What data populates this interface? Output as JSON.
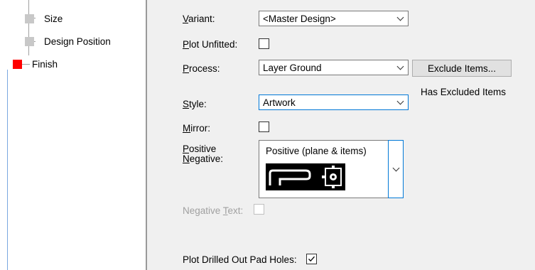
{
  "tree": {
    "items": [
      {
        "label": "Size"
      },
      {
        "label": "Design Position"
      },
      {
        "label": "Finish"
      }
    ]
  },
  "form": {
    "variant": {
      "label_u": "V",
      "label_rest": "ariant:",
      "value": "<Master Design>"
    },
    "plot_unfitted": {
      "label_u": "P",
      "label_rest": "lot Unfitted:",
      "checked": false
    },
    "process": {
      "label_u": "P",
      "label_rest": "rocess:",
      "value": "Layer Ground"
    },
    "exclude_button": "Exclude Items...",
    "excluded_status": "Has Excluded Items",
    "style": {
      "label_u": "S",
      "label_rest": "tyle:",
      "value": "Artwork"
    },
    "mirror": {
      "label_u": "M",
      "label_rest": "irror:",
      "checked": false
    },
    "positive_negative": {
      "label_line1_u": "P",
      "label_line1_rest": "ositive",
      "label_line2_u": "N",
      "label_line2_rest": "egative:",
      "value": "Positive (plane & items)"
    },
    "negative_text": {
      "label_pre": "Negative ",
      "label_u": "T",
      "label_rest": "ext:",
      "checked": false,
      "enabled": false
    },
    "plot_drilled": {
      "label": "Plot Drilled Out Pad Holes:",
      "checked": true
    }
  },
  "colors": {
    "finish_node": "#ff0000",
    "focus_border": "#0078d7"
  }
}
